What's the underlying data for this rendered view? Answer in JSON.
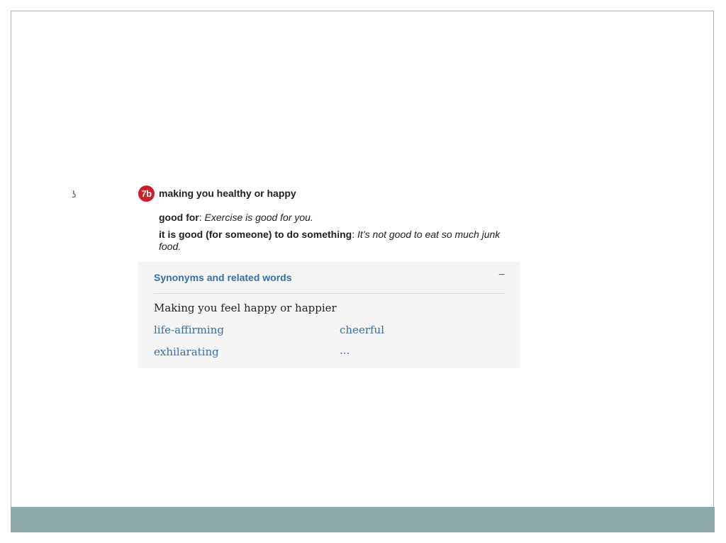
{
  "entry": {
    "sense_number": "7b",
    "sense_title": "making you healthy or happy",
    "examples": [
      {
        "phrase": "good for",
        "separator": ": ",
        "sentence": "Exercise is good for you."
      },
      {
        "phrase": "it is good (for someone) to do something",
        "separator": ": ",
        "sentence": "It’s not good to eat so much junk food."
      }
    ]
  },
  "synonyms": {
    "title": "Synonyms and related words",
    "collapse_label": "−",
    "sense": "Making you feel happy or happier",
    "words": [
      "life-affirming",
      "cheerful",
      "exhilarating",
      "..."
    ]
  },
  "colors": {
    "badge": "#cc1f2d",
    "link": "#3a6ea5",
    "footer": "#8eabab",
    "panel": "#f5f5f5"
  }
}
